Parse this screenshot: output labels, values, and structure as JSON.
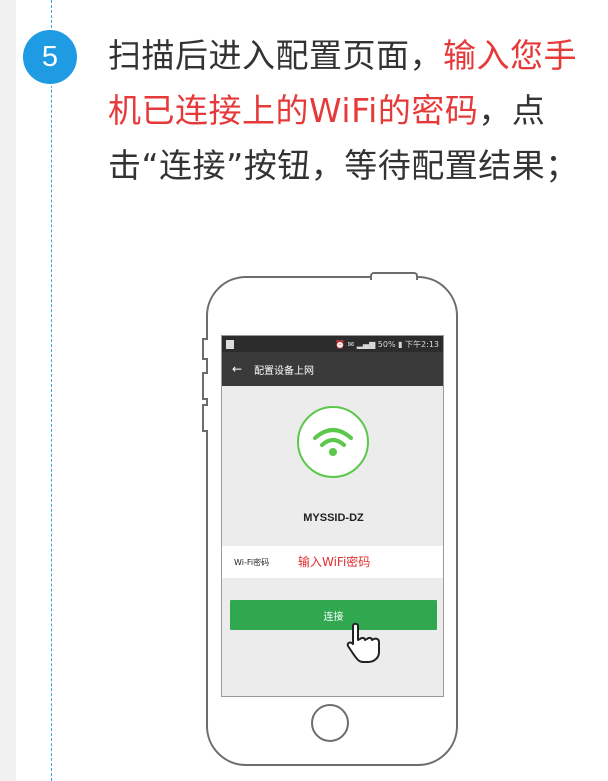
{
  "step": {
    "number": "5",
    "text_part1": "扫描后进入配置页面，",
    "text_highlight": "输入您手机已连接上的WiFi的密码",
    "text_part2": "，点击“连接”按钮，等待配置结果；"
  },
  "phone": {
    "status_bar": {
      "right": "⏰ ✉ ▂▄▆ 50% ▮ 下午2:13"
    },
    "title_bar": {
      "title": "配置设备上网"
    },
    "ssid": "MYSSID-DZ",
    "password_label": "Wi-Fi密码",
    "password_placeholder": "输入WiFi密码",
    "connect_label": "连接"
  },
  "colors": {
    "accent_blue": "#1e9be2",
    "highlight_red": "#e63a3a",
    "button_green": "#2fa84f",
    "wifi_green": "#5cc84b"
  }
}
